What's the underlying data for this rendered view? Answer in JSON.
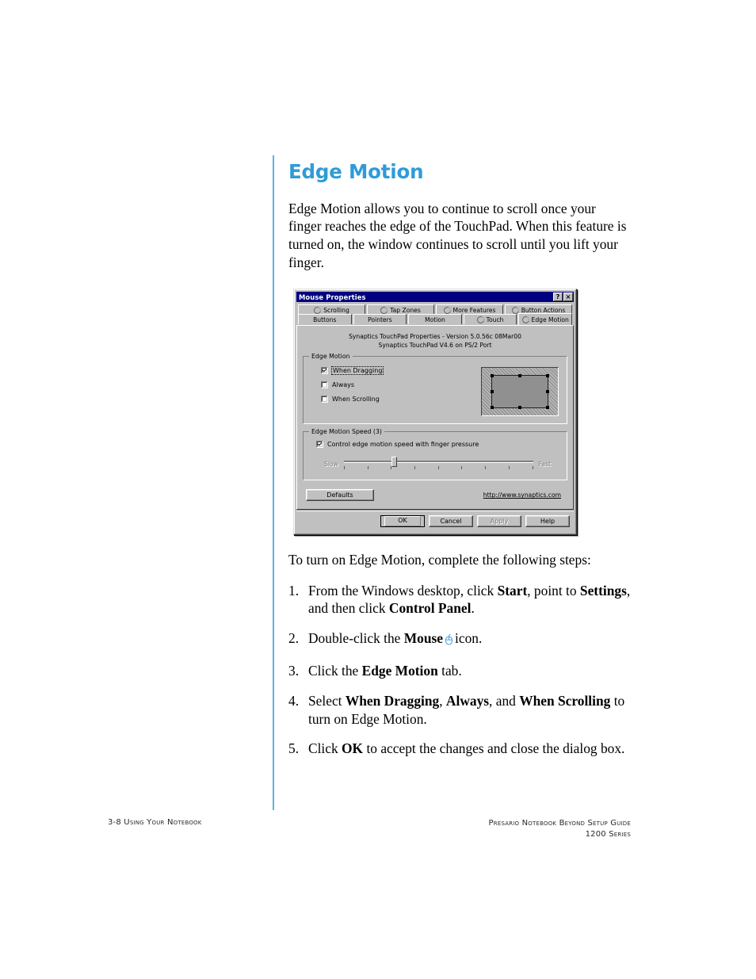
{
  "page": {
    "heading": "Edge Motion",
    "intro_paragraph": "Edge Motion allows you to continue to scroll once your finger reaches the edge of the TouchPad. When this feature is turned on, the window continues to scroll until you lift your finger.",
    "steps_lead_in": "To turn on Edge Motion, complete the following steps:",
    "accent_color": "#2f9bd8",
    "rule_color": "#5fb0e5"
  },
  "steps": [
    {
      "num": "1.",
      "parts": [
        {
          "text": "From the Windows desktop, click ",
          "bold": false
        },
        {
          "text": "Start",
          "bold": true
        },
        {
          "text": ", point to ",
          "bold": false
        },
        {
          "text": "Settings",
          "bold": true
        },
        {
          "text": ", and then click ",
          "bold": false
        },
        {
          "text": "Control Panel",
          "bold": true
        },
        {
          "text": ".",
          "bold": false
        }
      ]
    },
    {
      "num": "2.",
      "parts": [
        {
          "text": "Double-click the ",
          "bold": false
        },
        {
          "text": "Mouse",
          "bold": true
        },
        {
          "text": " ",
          "bold": false
        },
        {
          "text": "icon.",
          "bold": false,
          "icon_before": "mouse-icon"
        }
      ]
    },
    {
      "num": "3.",
      "parts": [
        {
          "text": "Click the ",
          "bold": false
        },
        {
          "text": "Edge Motion",
          "bold": true
        },
        {
          "text": " tab.",
          "bold": false
        }
      ]
    },
    {
      "num": "4.",
      "parts": [
        {
          "text": "Select ",
          "bold": false
        },
        {
          "text": "When Dragging",
          "bold": true
        },
        {
          "text": ", ",
          "bold": false
        },
        {
          "text": "Always",
          "bold": true
        },
        {
          "text": ", and ",
          "bold": false
        },
        {
          "text": "When Scrolling",
          "bold": true
        },
        {
          "text": " to turn on Edge Motion.",
          "bold": false
        }
      ]
    },
    {
      "num": "5.",
      "parts": [
        {
          "text": "Click ",
          "bold": false
        },
        {
          "text": "OK",
          "bold": true
        },
        {
          "text": " to accept the changes and close the dialog box.",
          "bold": false
        }
      ]
    }
  ],
  "dialog": {
    "title": "Mouse Properties",
    "titlebar_buttons": [
      {
        "name": "help-button",
        "glyph": "?"
      },
      {
        "name": "close-button",
        "glyph": "×"
      }
    ],
    "tabs_row1": [
      {
        "label": "Scrolling",
        "selected": false,
        "has_icon": true
      },
      {
        "label": "Tap Zones",
        "selected": false,
        "has_icon": true
      },
      {
        "label": "More Features",
        "selected": false,
        "has_icon": true
      },
      {
        "label": "Button Actions",
        "selected": false,
        "has_icon": true
      }
    ],
    "tabs_row2": [
      {
        "label": "Buttons",
        "selected": false,
        "has_icon": false
      },
      {
        "label": "Pointers",
        "selected": false,
        "has_icon": false
      },
      {
        "label": "Motion",
        "selected": false,
        "has_icon": false
      },
      {
        "label": "Touch",
        "selected": false,
        "has_icon": true
      },
      {
        "label": "Edge Motion",
        "selected": true,
        "has_icon": true
      }
    ],
    "version_line1": "Synaptics TouchPad Properties - Version 5.0.56c 08Mar00",
    "version_line2": "Synaptics TouchPad V4.6 on PS/2 Port",
    "edge_motion_group": {
      "title": "Edge Motion",
      "checkboxes": [
        {
          "label": "When Dragging",
          "checked": true,
          "focused": true,
          "accel": "W"
        },
        {
          "label": "Always",
          "checked": false,
          "focused": false,
          "accel": "l"
        },
        {
          "label": "When Scrolling",
          "checked": false,
          "focused": false,
          "accel": "S"
        }
      ]
    },
    "speed_group": {
      "title": "Edge Motion Speed (3)",
      "checkbox": {
        "label": "Control edge motion speed with finger pressure",
        "checked": true
      },
      "slider": {
        "min_label": "Slow",
        "max_label": "Fast",
        "value": 3,
        "ticks": 9
      }
    },
    "defaults_button": "Defaults",
    "web_link": "http://www.synaptics.com",
    "footer_buttons": [
      {
        "label": "OK",
        "default": true,
        "disabled": false
      },
      {
        "label": "Cancel",
        "default": false,
        "disabled": false
      },
      {
        "label": "Apply",
        "default": false,
        "disabled": true
      },
      {
        "label": "Help",
        "default": false,
        "disabled": false
      }
    ]
  },
  "footer": {
    "left": "3-8   Using Your Notebook",
    "right_line1": "Presario Notebook Beyond Setup Guide",
    "right_line2": "1200 Series"
  }
}
